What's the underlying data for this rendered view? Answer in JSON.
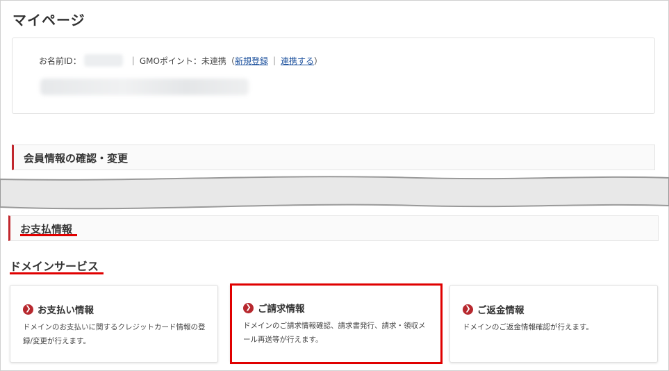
{
  "page": {
    "title": "マイページ"
  },
  "account": {
    "id_label": "お名前ID：",
    "points_label": "GMOポイント：未連携（",
    "register_link": "新規登録",
    "separator": "|",
    "link_account": "連携する",
    "points_close": "）"
  },
  "sections": {
    "member_info": "会員情報の確認・変更",
    "payment_info": "お支払情報"
  },
  "domain_service": {
    "heading": "ドメインサービス",
    "cards": [
      {
        "title": "お支払い情報",
        "desc": "ドメインのお支払いに関するクレジットカード情報の登録/変更が行えます。"
      },
      {
        "title": "ご請求情報",
        "desc": "ドメインのご請求情報確認、請求書発行、請求・領収メール再送等が行えます。"
      },
      {
        "title": "ご返金情報",
        "desc": "ドメインのご返金情報確認が行えます。"
      }
    ]
  },
  "colors": {
    "accent_red": "#c1272d",
    "highlight_red": "#e00000",
    "link_blue": "#1a4f9c"
  },
  "icons": {
    "card_arrow": "chevron-right-circle-icon"
  }
}
